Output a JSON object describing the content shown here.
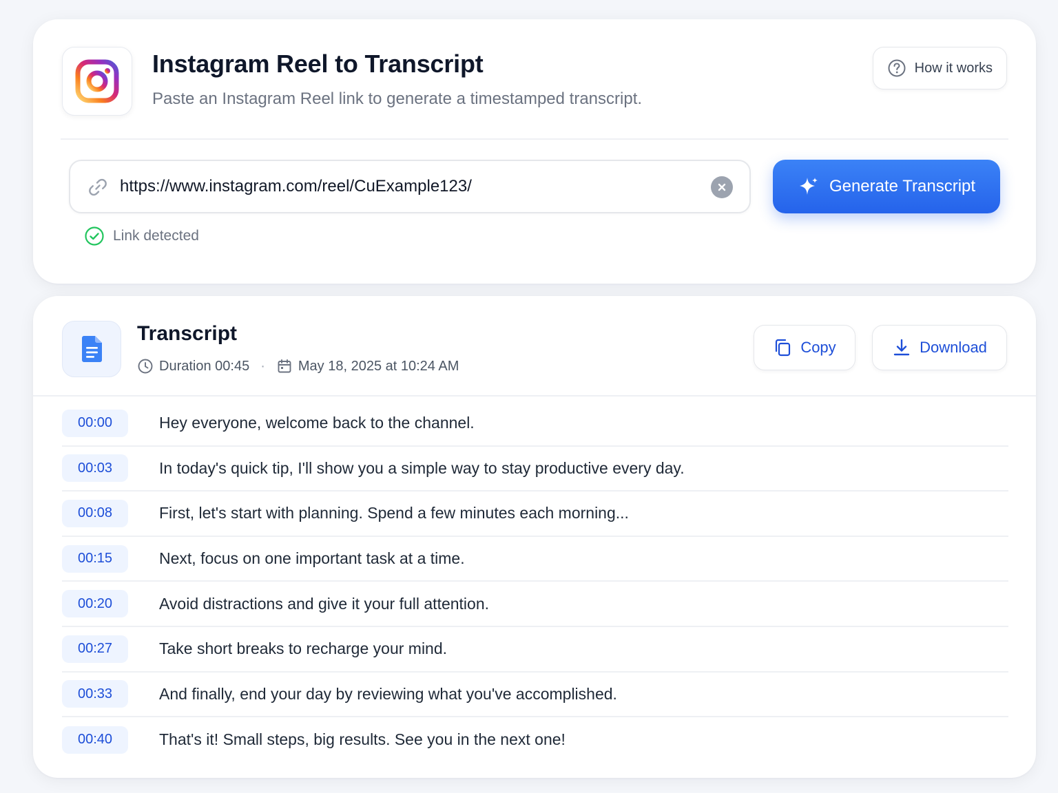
{
  "header": {
    "title": "Instagram Reel to Transcript",
    "subtitle": "Paste an Instagram Reel link to generate a timestamped transcript.",
    "help_label": "How it works"
  },
  "url_form": {
    "value": "https://www.instagram.com/reel/CuExample123/",
    "generate_label": "Generate Transcript",
    "status": "Link detected"
  },
  "transcript": {
    "title": "Transcript",
    "duration": "Duration 00:45",
    "date": "May 18, 2025 at 10:24 AM",
    "copy_label": "Copy",
    "download_label": "Download",
    "lines": [
      {
        "time": "00:00",
        "text": "Hey everyone, welcome back to the channel."
      },
      {
        "time": "00:03",
        "text": "In today's quick tip, I'll show you a simple way to stay productive every day."
      },
      {
        "time": "00:08",
        "text": "First, let's start with planning. Spend a few minutes each morning..."
      },
      {
        "time": "00:15",
        "text": "Next, focus on one important task at a time."
      },
      {
        "time": "00:20",
        "text": "Avoid distractions and give it your full attention."
      },
      {
        "time": "00:27",
        "text": "Take short breaks to recharge your mind."
      },
      {
        "time": "00:33",
        "text": "And finally, end your day by reviewing what you've accomplished."
      },
      {
        "time": "00:40",
        "text": "That's it! Small steps, big results. See you in the next one!"
      }
    ]
  },
  "icons": {
    "app_logo": "instagram-icon",
    "help": "question-circle-icon",
    "link": "link-icon",
    "clear": "close-circle-icon",
    "generate": "sparkle-icon",
    "status": "check-circle-icon",
    "document": "document-icon",
    "duration": "clock-icon",
    "date": "calendar-icon",
    "copy": "copy-icon",
    "download": "download-icon"
  },
  "colors": {
    "accent": "#2563eb",
    "success": "#22c55e",
    "timestamp_bg": "#eef4ff"
  }
}
